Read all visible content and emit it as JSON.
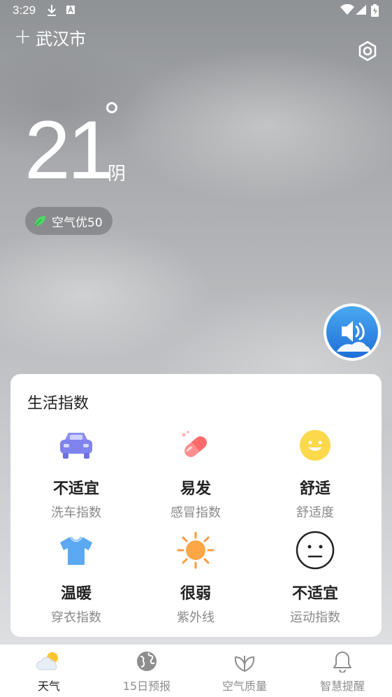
{
  "status_bar": {
    "time": "3:29"
  },
  "header": {
    "city": "武汉市"
  },
  "weather": {
    "temperature": "21",
    "condition": "阴",
    "aqi_text": "空气优50"
  },
  "life_index": {
    "title": "生活指数",
    "items": [
      {
        "value": "不适宜",
        "label": "洗车指数",
        "icon": "car-icon"
      },
      {
        "value": "易发",
        "label": "感冒指数",
        "icon": "pill-icon"
      },
      {
        "value": "舒适",
        "label": "舒适度",
        "icon": "smiley-icon"
      },
      {
        "value": "温暖",
        "label": "穿衣指数",
        "icon": "tshirt-icon"
      },
      {
        "value": "很弱",
        "label": "紫外线",
        "icon": "sun-icon"
      },
      {
        "value": "不适宜",
        "label": "运动指数",
        "icon": "neutral-face-icon"
      }
    ]
  },
  "tabs": [
    {
      "label": "天气",
      "icon": "weather-icon",
      "active": true
    },
    {
      "label": "15日预报",
      "icon": "globe-icon",
      "active": false
    },
    {
      "label": "空气质量",
      "icon": "leaf-icon",
      "active": false
    },
    {
      "label": "智慧提醒",
      "icon": "bell-icon",
      "active": false
    }
  ],
  "colors": {
    "aqi_green": "#4cd964",
    "accent_blue": "#3a8ee6",
    "card_bg": "#ffffff"
  }
}
